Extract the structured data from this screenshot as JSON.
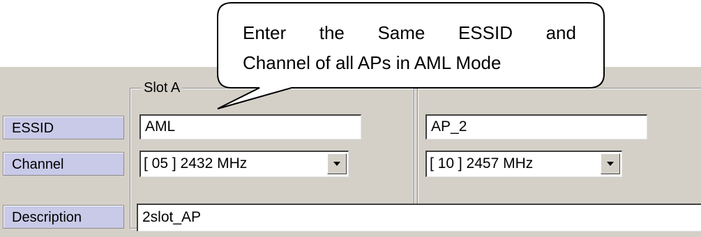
{
  "slot_a": {
    "legend": "Slot A",
    "essid_value": "AML",
    "channel_value": "[ 05 ] 2432 MHz"
  },
  "slot_b": {
    "essid_value": "AP_2",
    "channel_value": "[ 10 ] 2457 MHz"
  },
  "labels": {
    "essid": "ESSID",
    "channel": "Channel",
    "description": "Description"
  },
  "description_value": "2slot_AP",
  "callout": {
    "words_line1": [
      "Enter",
      "the",
      "Same",
      "ESSID",
      "and"
    ],
    "line2": "Channel of all APs in AML Mode"
  },
  "colors": {
    "panel": "#d4d0c8",
    "label_bg": "#c9c9e8"
  },
  "icons": {
    "dropdown": "chevron-down-icon"
  }
}
